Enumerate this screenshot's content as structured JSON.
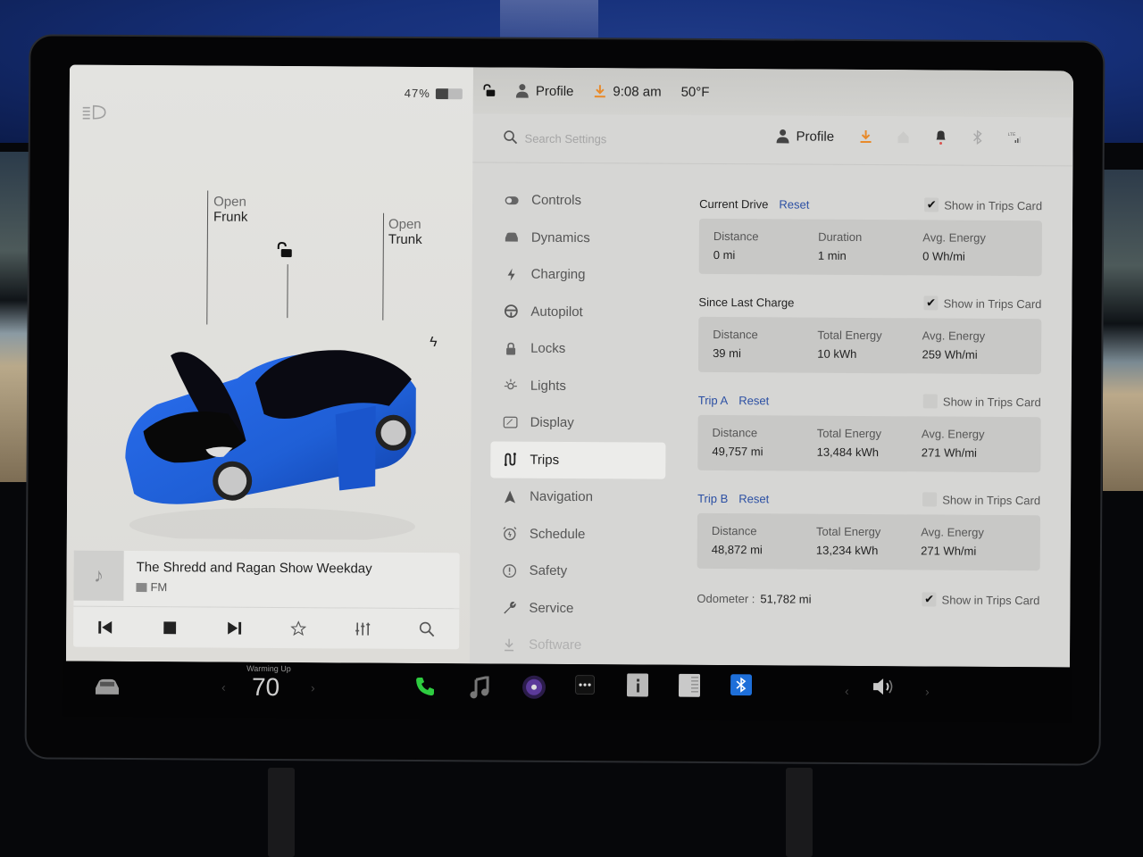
{
  "status_bar": {
    "battery_percent": "47%",
    "battery_level": 0.47,
    "profile_label": "Profile",
    "time": "9:08 am",
    "temperature": "50°F"
  },
  "car_panel": {
    "frunk": {
      "line1": "Open",
      "line2": "Frunk"
    },
    "trunk": {
      "line1": "Open",
      "line2": "Trunk"
    },
    "car_color": "#1f5fd6"
  },
  "media": {
    "title": "The Shredd and Ragan Show Weekday",
    "source": "FM",
    "controls": [
      "previous",
      "stop",
      "next",
      "favorite",
      "equalizer",
      "search"
    ]
  },
  "settings": {
    "search_placeholder": "Search Settings",
    "profile_label": "Profile",
    "menu": [
      {
        "label": "Controls",
        "icon": "toggle-icon"
      },
      {
        "label": "Dynamics",
        "icon": "car-icon"
      },
      {
        "label": "Charging",
        "icon": "bolt-icon"
      },
      {
        "label": "Autopilot",
        "icon": "steering-wheel-icon"
      },
      {
        "label": "Locks",
        "icon": "lock-icon"
      },
      {
        "label": "Lights",
        "icon": "sun-icon"
      },
      {
        "label": "Display",
        "icon": "display-icon"
      },
      {
        "label": "Trips",
        "icon": "trips-icon",
        "active": true
      },
      {
        "label": "Navigation",
        "icon": "navigation-icon"
      },
      {
        "label": "Schedule",
        "icon": "alarm-clock-icon"
      },
      {
        "label": "Safety",
        "icon": "alert-circle-icon"
      },
      {
        "label": "Service",
        "icon": "wrench-icon"
      },
      {
        "label": "Software",
        "icon": "download-icon"
      }
    ]
  },
  "trips": {
    "show_label": "Show in Trips Card",
    "reset_label": "Reset",
    "current_drive": {
      "title": "Current Drive",
      "show_checked": true,
      "cols": [
        {
          "k": "Distance",
          "v": "0 mi"
        },
        {
          "k": "Duration",
          "v": "1 min"
        },
        {
          "k": "Avg. Energy",
          "v": "0 Wh/mi"
        }
      ]
    },
    "since_last_charge": {
      "title": "Since Last Charge",
      "show_checked": true,
      "cols": [
        {
          "k": "Distance",
          "v": "39 mi"
        },
        {
          "k": "Total Energy",
          "v": "10 kWh"
        },
        {
          "k": "Avg. Energy",
          "v": "259 Wh/mi"
        }
      ]
    },
    "trip_a": {
      "title": "Trip A",
      "show_checked": false,
      "cols": [
        {
          "k": "Distance",
          "v": "49,757 mi"
        },
        {
          "k": "Total Energy",
          "v": "13,484 kWh"
        },
        {
          "k": "Avg. Energy",
          "v": "271 Wh/mi"
        }
      ]
    },
    "trip_b": {
      "title": "Trip B",
      "show_checked": false,
      "cols": [
        {
          "k": "Distance",
          "v": "48,872 mi"
        },
        {
          "k": "Total Energy",
          "v": "13,234 kWh"
        },
        {
          "k": "Avg. Energy",
          "v": "271 Wh/mi"
        }
      ]
    },
    "odometer": {
      "label": "Odometer :",
      "value": "51,782 mi",
      "show_checked": true
    }
  },
  "dock": {
    "climate_status": "Warming Up",
    "climate_temp": "70",
    "apps": [
      "car",
      "phone",
      "music",
      "camera",
      "more",
      "manual",
      "calendar",
      "bluetooth",
      "volume"
    ],
    "colors": {
      "phone": "#2ecc40",
      "bluetooth": "#1e6fd9",
      "camera": "#5b3a9a"
    }
  }
}
